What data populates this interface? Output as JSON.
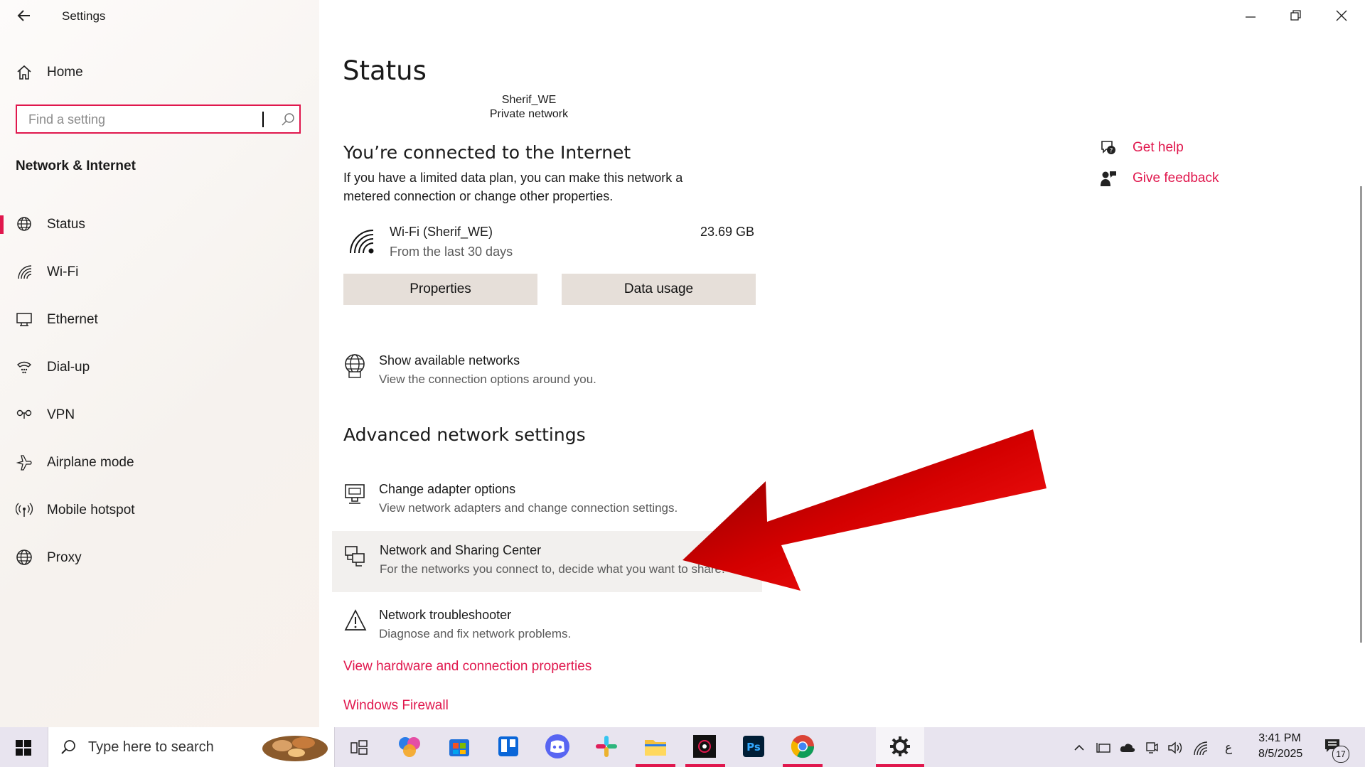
{
  "window": {
    "title": "Settings"
  },
  "sidebar": {
    "home_label": "Home",
    "search_placeholder": "Find a setting",
    "section_title": "Network & Internet",
    "items": [
      {
        "label": "Status",
        "icon": "globe-status-icon"
      },
      {
        "label": "Wi-Fi",
        "icon": "wifi-icon"
      },
      {
        "label": "Ethernet",
        "icon": "ethernet-icon"
      },
      {
        "label": "Dial-up",
        "icon": "dialup-icon"
      },
      {
        "label": "VPN",
        "icon": "vpn-icon"
      },
      {
        "label": "Airplane mode",
        "icon": "airplane-icon"
      },
      {
        "label": "Mobile hotspot",
        "icon": "hotspot-icon"
      },
      {
        "label": "Proxy",
        "icon": "globe-icon"
      }
    ]
  },
  "main": {
    "page_title": "Status",
    "network_name": "Sherif_WE",
    "network_type": "Private network",
    "connected_heading": "You’re connected to the Internet",
    "connected_desc_1": "If you have a limited data plan, you can make this network a",
    "connected_desc_2": "metered connection or change other properties.",
    "wifi_name": "Wi-Fi (Sherif_WE)",
    "wifi_period": "From the last 30 days",
    "wifi_usage": "23.69 GB",
    "properties_button": "Properties",
    "data_usage_button": "Data usage",
    "show_networks_title": "Show available networks",
    "show_networks_desc": "View the connection options around you.",
    "advanced_heading": "Advanced network settings",
    "adapter_title": "Change adapter options",
    "adapter_desc": "View network adapters and change connection settings.",
    "sharing_title": "Network and Sharing Center",
    "sharing_desc": "For the networks you connect to, decide what you want to share.",
    "troubleshooter_title": "Network troubleshooter",
    "troubleshooter_desc": "Diagnose and fix network problems.",
    "hardware_link": "View hardware and connection properties",
    "firewall_link": "Windows Firewall",
    "get_help": "Get help",
    "give_feedback": "Give feedback"
  },
  "taskbar": {
    "search_placeholder": "Type here to search",
    "time": "3:41 PM",
    "date": "8/5/2025",
    "notification_count": "17",
    "lang": "ع"
  },
  "colors": {
    "accent": "#e0174d",
    "arrow": "#d40000"
  }
}
